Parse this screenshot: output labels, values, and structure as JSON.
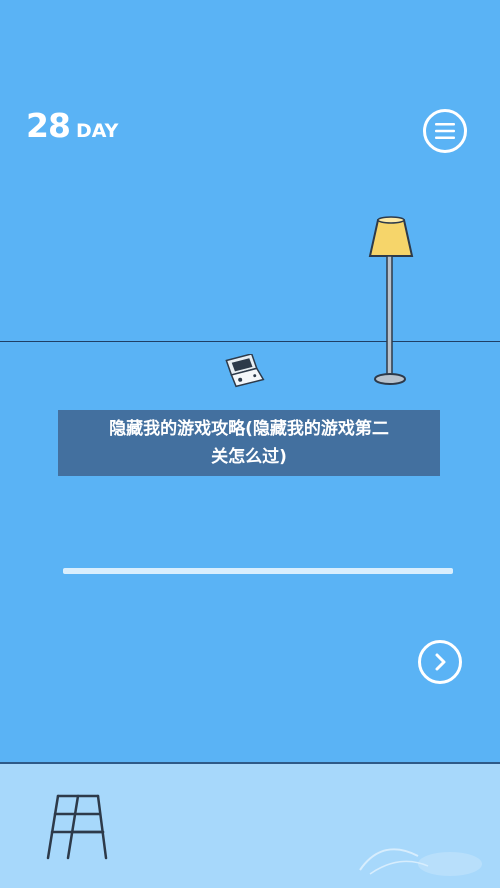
{
  "hud": {
    "day_number": "28",
    "day_label": "DAY",
    "menu_icon": "hamburger-menu-icon",
    "next_icon": "chevron-right-icon"
  },
  "overlay": {
    "title_line1": "隐藏我的游戏攻略(隐藏我的游戏第二",
    "title_line2": "关怎么过)"
  },
  "scene": {
    "items": [
      "floor-lamp",
      "handheld-game-console"
    ],
    "background_color": "#5ab3f5"
  },
  "inventory": {
    "items": [
      "ladder"
    ],
    "background_color": "#a7d8fb"
  }
}
